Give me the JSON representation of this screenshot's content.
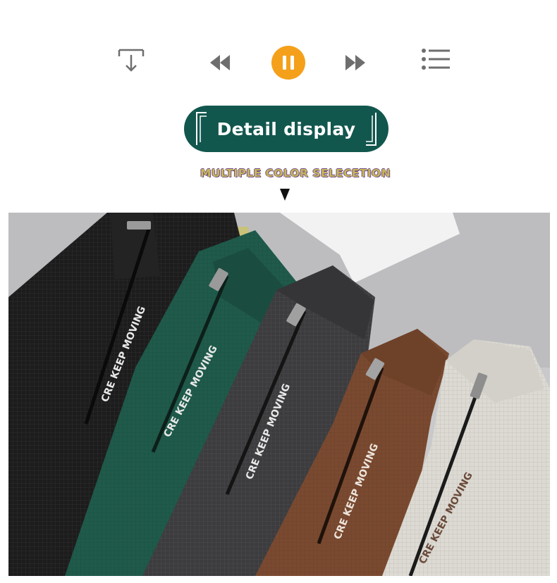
{
  "player": {
    "controls": [
      {
        "name": "download",
        "icon": "download-icon"
      },
      {
        "name": "rewind",
        "icon": "rewind-icon"
      },
      {
        "name": "pause",
        "icon": "pause-icon"
      },
      {
        "name": "forward",
        "icon": "fast-forward-icon"
      },
      {
        "name": "playlist",
        "icon": "playlist-icon"
      }
    ],
    "accent_color": "#f5a01a",
    "icon_color": "#6e6e6e"
  },
  "header": {
    "title": "Detail display",
    "subtitle": "MULTIPLE COLOR SELECETION",
    "pill_color": "#12574e"
  },
  "photo": {
    "garments": [
      {
        "color_name": "black",
        "color": "#1c1c1c",
        "print": "CRE KEEP MOVING"
      },
      {
        "color_name": "green",
        "color": "#1f5a4a",
        "print": "CRE KEEP MOVING"
      },
      {
        "color_name": "dark gray",
        "color": "#3c3c3e",
        "print": "CRE KEEP MOVING"
      },
      {
        "color_name": "brown",
        "color": "#7a4a30",
        "print": "CRE KEEP MOVING"
      },
      {
        "color_name": "off-white",
        "color": "#dcdad3",
        "print": "CRE KEEP MOVING"
      }
    ]
  }
}
